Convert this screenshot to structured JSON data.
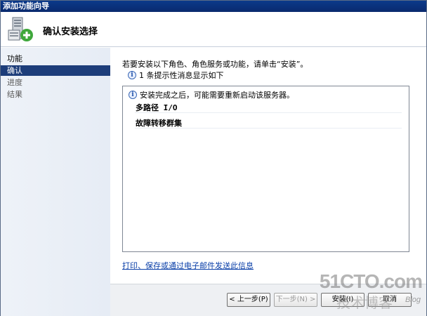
{
  "window": {
    "title": "添加功能向导"
  },
  "header": {
    "title": "确认安装选择"
  },
  "sidebar": {
    "items": [
      {
        "label": "功能",
        "state": "normal"
      },
      {
        "label": "确认",
        "state": "active"
      },
      {
        "label": "进度",
        "state": "dim"
      },
      {
        "label": "结果",
        "state": "dim"
      }
    ]
  },
  "main": {
    "intro": "若要安装以下角色、角色服务或功能，请单击“安装”。",
    "hint": "1 条提示性消息显示如下",
    "list": {
      "info": "安装完成之后，可能需要重新启动该服务器。",
      "items": [
        "多路径 I/O",
        "故障转移群集"
      ]
    },
    "link": "打印、保存或通过电子邮件发送此信息"
  },
  "footer": {
    "prev": "< 上一步(P)",
    "next": "下一步(N) >",
    "install": "安装(I)",
    "cancel": "取消"
  },
  "watermark": {
    "main": "51CTO.com",
    "sub": "技术博客",
    "blog": "Blog"
  },
  "colors": {
    "accent": "#1d3d7a",
    "link": "#0a3fa8"
  }
}
